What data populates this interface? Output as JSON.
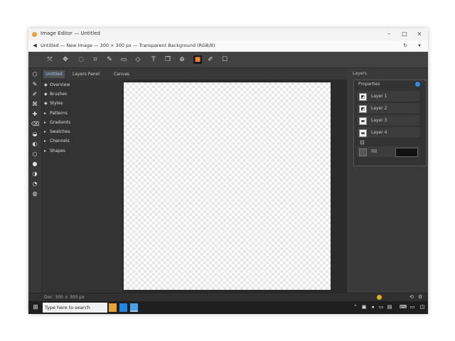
{
  "window": {
    "title": "Image Editor — Untitled",
    "addr_text": "Untitled — New Image — 300 × 300 px — Transparent Background (RGB/8)"
  },
  "toolbar": {
    "tools": [
      "cursor-icon",
      "move-icon",
      "lasso-icon",
      "crop-icon",
      "brush-icon",
      "eraser-icon",
      "shape-icon",
      "text-icon",
      "copy-icon",
      "zoom-icon",
      "color-icon",
      "eyedropper-icon"
    ]
  },
  "tabs": [
    {
      "label": "Untitled"
    },
    {
      "label": "Layers Panel"
    },
    {
      "label": "Canvas"
    }
  ],
  "left_panel": {
    "items": [
      {
        "glyph": "◆",
        "label": "Overview"
      },
      {
        "glyph": "◆",
        "label": "Brushes"
      },
      {
        "glyph": "◆",
        "label": "Styles"
      },
      {
        "glyph": "▸",
        "label": "Patterns"
      },
      {
        "glyph": "▸",
        "label": "Gradients"
      },
      {
        "glyph": "▸",
        "label": "Swatches"
      },
      {
        "glyph": "▸",
        "label": "Channels"
      },
      {
        "glyph": "▸",
        "label": "Shapes"
      }
    ]
  },
  "right_panel": {
    "header": "Layers",
    "props_title": "Properties",
    "layers": [
      {
        "name": "Layer 1",
        "glyph": "◩"
      },
      {
        "name": "Layer 2",
        "glyph": "◩"
      },
      {
        "name": "Layer 3",
        "glyph": "▬"
      },
      {
        "name": "Layer 4",
        "glyph": "▬"
      }
    ],
    "fill_label": "Fill"
  },
  "statusbar": {
    "text": "Doc: 300 × 300 px"
  },
  "taskbar": {
    "search_placeholder": "Type here to search",
    "time": ""
  }
}
